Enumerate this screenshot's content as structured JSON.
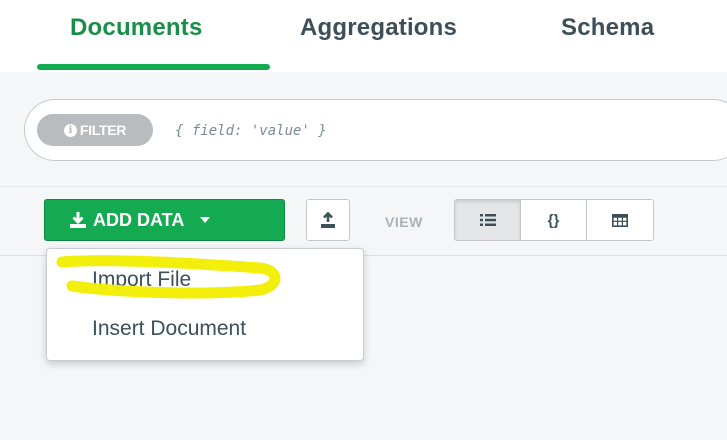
{
  "tabs": [
    {
      "label": "Documents",
      "active": true
    },
    {
      "label": "Aggregations",
      "active": false
    },
    {
      "label": "Schema",
      "active": false
    }
  ],
  "filter": {
    "label": "FILTER",
    "info_icon": "i",
    "placeholder": "{ field: 'value' }"
  },
  "toolbar": {
    "add_data_label": "ADD DATA",
    "view_label": "VIEW",
    "view_modes": [
      {
        "icon": "list-icon",
        "active": true
      },
      {
        "icon": "json-icon",
        "glyph": "{}",
        "active": false
      },
      {
        "icon": "table-icon",
        "active": false
      }
    ]
  },
  "add_data_menu": {
    "items": [
      "Import File",
      "Insert Document"
    ]
  },
  "colors": {
    "accent_green": "#13aa52",
    "highlight_yellow": "#f2ee00",
    "text": "#3d4f58"
  }
}
